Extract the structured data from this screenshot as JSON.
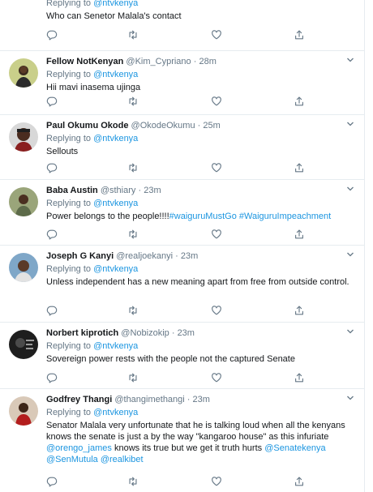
{
  "tweets": [
    {
      "text": "Who can Senetor Malala's contact",
      "replying_prefix": "Replying to",
      "replying_to": "@ntvkenya"
    },
    {
      "name": "Fellow NotKenyan",
      "handle": "@Kim_Cypriano",
      "separator": "·",
      "time": "28m",
      "replying_prefix": "Replying to",
      "replying_to": "@ntvkenya",
      "text": "Hii mavi inasema ujinga"
    },
    {
      "name": "Paul Okumu Okode",
      "handle": "@OkodeOkumu",
      "separator": "·",
      "time": "25m",
      "replying_prefix": "Replying to",
      "replying_to": "@ntvkenya",
      "text": "Sellouts"
    },
    {
      "name": "Baba Austin",
      "handle": "@sthiary",
      "separator": "·",
      "time": "23m",
      "replying_prefix": "Replying to",
      "replying_to": "@ntvkenya",
      "text_prefix": "Power belongs to the people!!!!",
      "hashtag1": "#waiguruMustGo",
      "hashtag2": "#WaiguruImpeachment"
    },
    {
      "name": "Joseph G Kanyi",
      "handle": "@realjoekanyi",
      "separator": "·",
      "time": "23m",
      "replying_prefix": "Replying to",
      "replying_to": "@ntvkenya",
      "text": "Unless independent has a new meaning apart from free from outside control."
    },
    {
      "name": "Norbert kiprotich",
      "handle": "@Nobizokip",
      "separator": "·",
      "time": "23m",
      "replying_prefix": "Replying to",
      "replying_to": "@ntvkenya",
      "text": "Sovereign power rests with the people not the captured Senate"
    },
    {
      "name": "Godfrey Thangi",
      "handle": "@thangimethangi",
      "separator": "·",
      "time": "23m",
      "replying_prefix": "Replying to",
      "replying_to": "@ntvkenya",
      "text_part1": "Senator Malala very unfortunate that he is talking loud when all the kenyans knows the senate is just a by the way \"kangaroo house\" as this infuriate",
      "mention1": "@orengo_james",
      "text_part2": "knows its true but we get it truth hurts",
      "mention2": "@Senatekenya",
      "mention3": "@SenMutula",
      "mention4": "@realkibet"
    }
  ],
  "icons": {
    "reply": "reply-icon",
    "retweet": "retweet-icon",
    "like": "like-icon",
    "share": "share-icon",
    "more": "chevron-down-icon"
  },
  "colors": {
    "link": "#1b95e0",
    "muted": "#657786",
    "text": "#14171a",
    "border": "#e6ecf0"
  }
}
